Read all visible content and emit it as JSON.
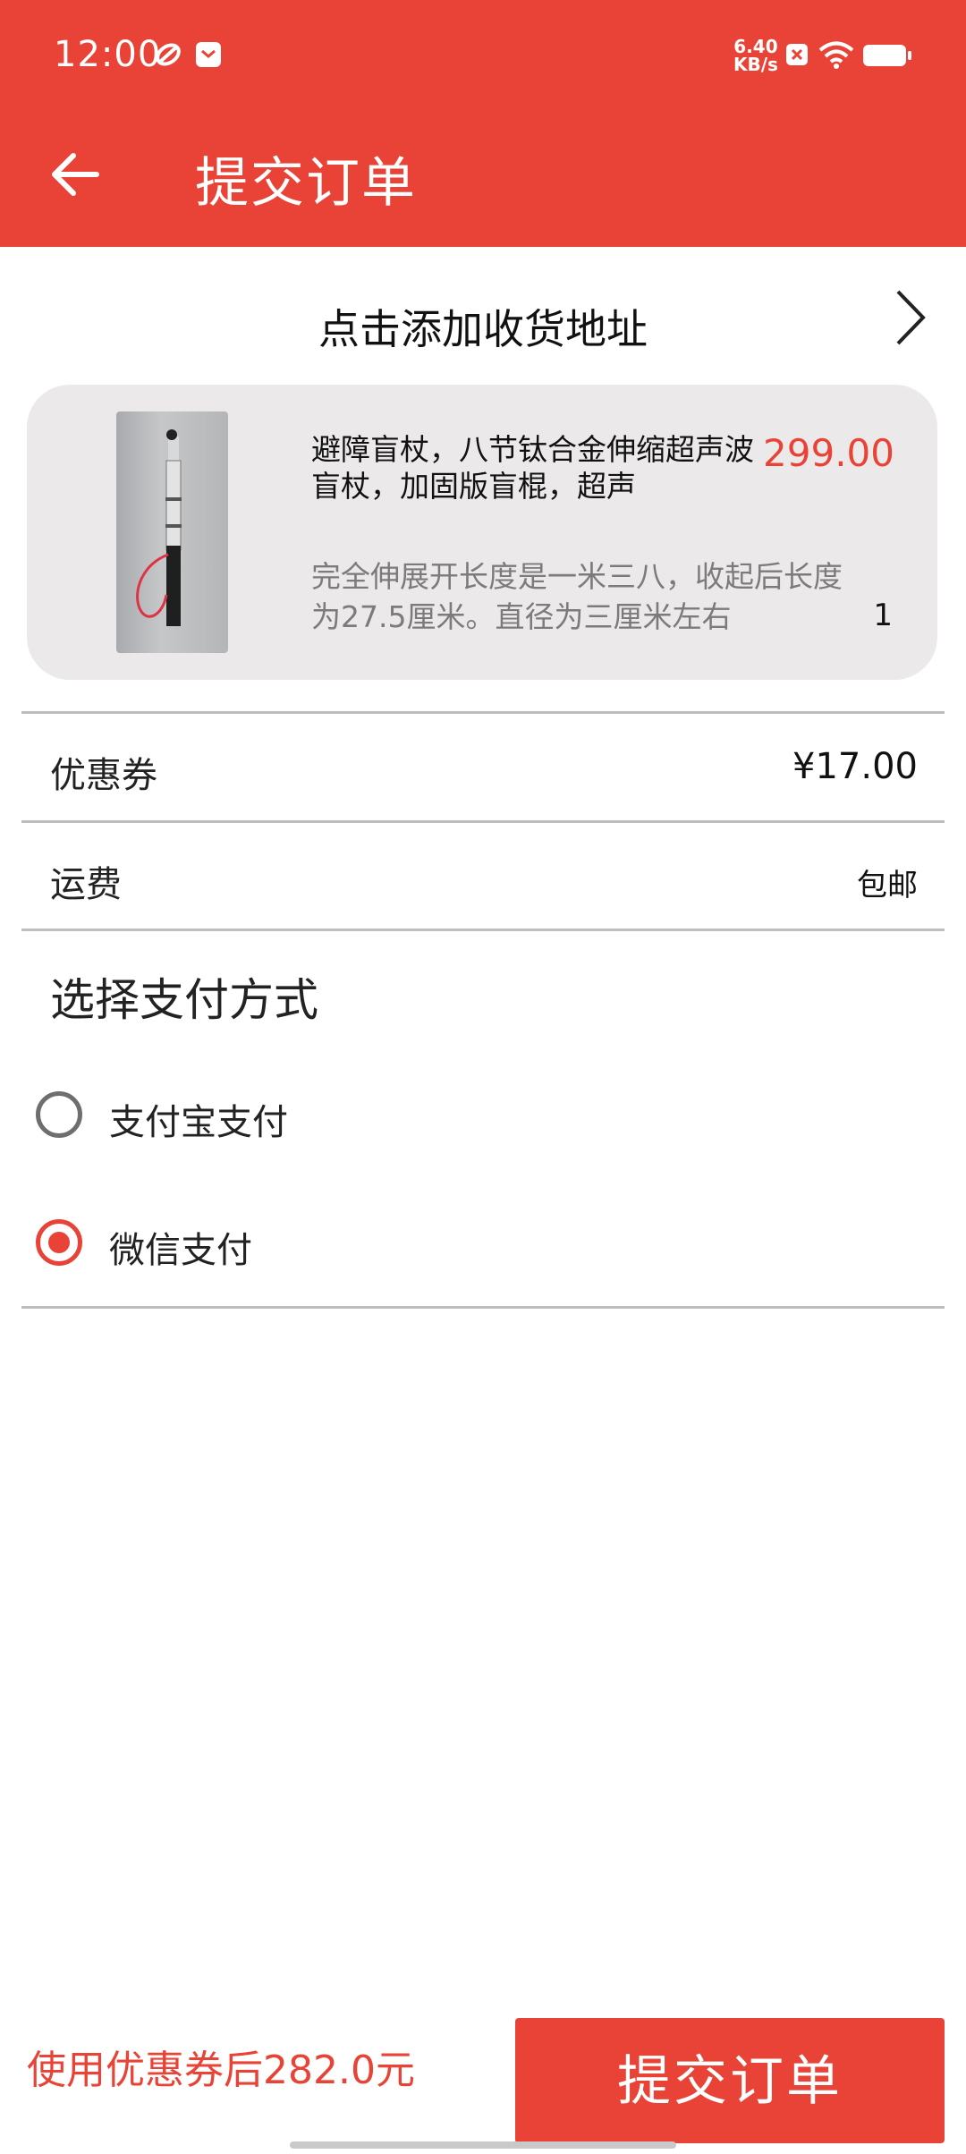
{
  "status_bar": {
    "time": "12:00",
    "network_speed_value": "6.40",
    "network_speed_unit": "KB/s"
  },
  "header": {
    "title": "提交订单",
    "back_icon": "arrow-left-icon"
  },
  "address": {
    "label": "点击添加收货地址",
    "chevron_icon": "chevron-right-icon"
  },
  "product": {
    "name": "避障盲杖，八节钛合金伸缩超声波盲杖，加固版盲棍，超声",
    "price": "299.00",
    "description": " 完全伸展开长度是一米三八，收起后长度为27.5厘米。直径为三厘米左右",
    "quantity": "1"
  },
  "coupon": {
    "label": "优惠券",
    "value": "¥17.00"
  },
  "shipping": {
    "label": "运费",
    "value": "包邮"
  },
  "payment": {
    "title": "选择支付方式",
    "options": [
      {
        "label": "支付宝支付",
        "selected": false
      },
      {
        "label": "微信支付",
        "selected": true
      }
    ]
  },
  "footer": {
    "total_text": "使用优惠券后282.0元",
    "submit_label": "提交订单"
  },
  "colors": {
    "accent": "#E84336"
  }
}
